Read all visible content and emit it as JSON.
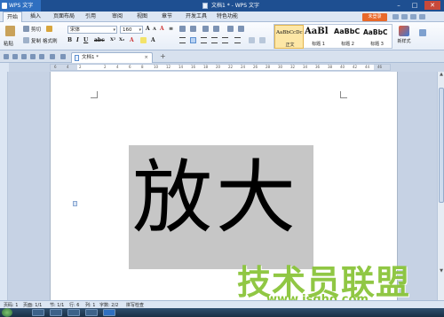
{
  "titlebar": {
    "app_name": "WPS 文字",
    "title": "文档1 * - WPS 文字",
    "controls": [
      "–",
      "□",
      "✕"
    ]
  },
  "menu": {
    "tabs": [
      "开始",
      "插入",
      "页面布局",
      "引用",
      "审阅",
      "视图",
      "章节",
      "开发工具",
      "特色功能"
    ],
    "unregistered": "未登录"
  },
  "ribbon": {
    "paste": "粘贴",
    "cut": "剪切",
    "copy": "复制",
    "format_painter": "格式刷",
    "font_name": "宋体",
    "font_size": "160",
    "styles": [
      {
        "sample": "AaBbCcDc",
        "name": "正文"
      },
      {
        "sample": "AaBl",
        "name": "标题 1"
      },
      {
        "sample": "AaBbC",
        "name": "标题 2"
      },
      {
        "sample": "AaBbC",
        "name": "标题 3"
      }
    ],
    "new_style": "新样式"
  },
  "tabs": {
    "doc_tab": "文档1 *",
    "close": "×",
    "add": "+"
  },
  "ruler": {
    "ticks": [
      "6",
      "4",
      "2",
      "",
      "2",
      "4",
      "6",
      "8",
      "10",
      "12",
      "14",
      "16",
      "18",
      "20",
      "22",
      "24",
      "26",
      "28",
      "30",
      "32",
      "34",
      "36",
      "38",
      "40",
      "42",
      "44",
      "46"
    ]
  },
  "document": {
    "text": "放大"
  },
  "status": {
    "page": "页码: 1",
    "pages": "页面: 1/1",
    "section": "节: 1/1",
    "line": "行: 6",
    "column": "列: 1",
    "words": "字数: 2/2",
    "spell": "拼写检查"
  },
  "watermark": {
    "main": "技术员联盟",
    "url": "www.jsgho.com"
  }
}
